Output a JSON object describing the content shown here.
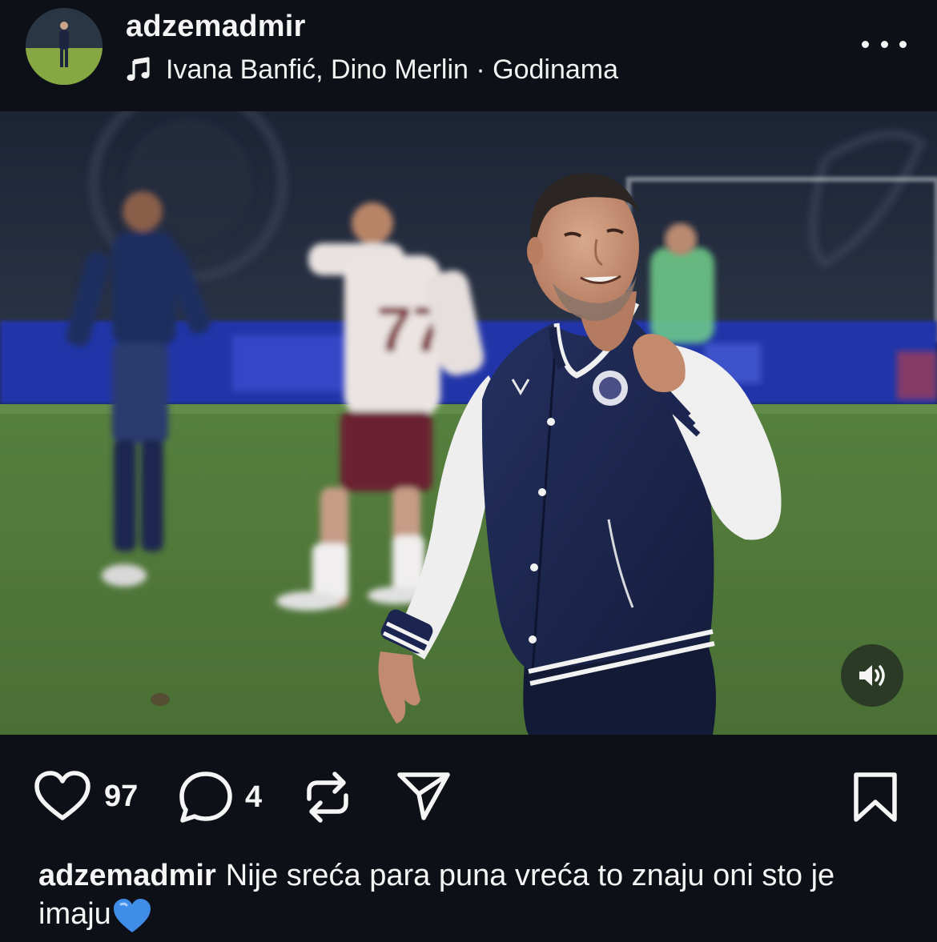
{
  "post": {
    "username": "adzemadmir",
    "music": "Ivana Banfić, Dino Merlin · Godinama",
    "likes": "97",
    "comments": "4",
    "caption": {
      "username": "adzemadmir",
      "text": "Nije sreća para puna vreća to znaju oni sto je imaju"
    }
  },
  "icons": {
    "music": "music-note-icon",
    "more": "more-horizontal-icon",
    "sound": "speaker-icon",
    "like": "heart-icon",
    "comment": "comment-icon",
    "repost": "repost-icon",
    "share": "send-icon",
    "save": "bookmark-icon",
    "emoji": "blue-heart-emoji"
  },
  "colors": {
    "background": "#0d1017",
    "text": "#f5f5f5",
    "jacket": "#1e2a55",
    "pitch": "#4f7a3a"
  }
}
